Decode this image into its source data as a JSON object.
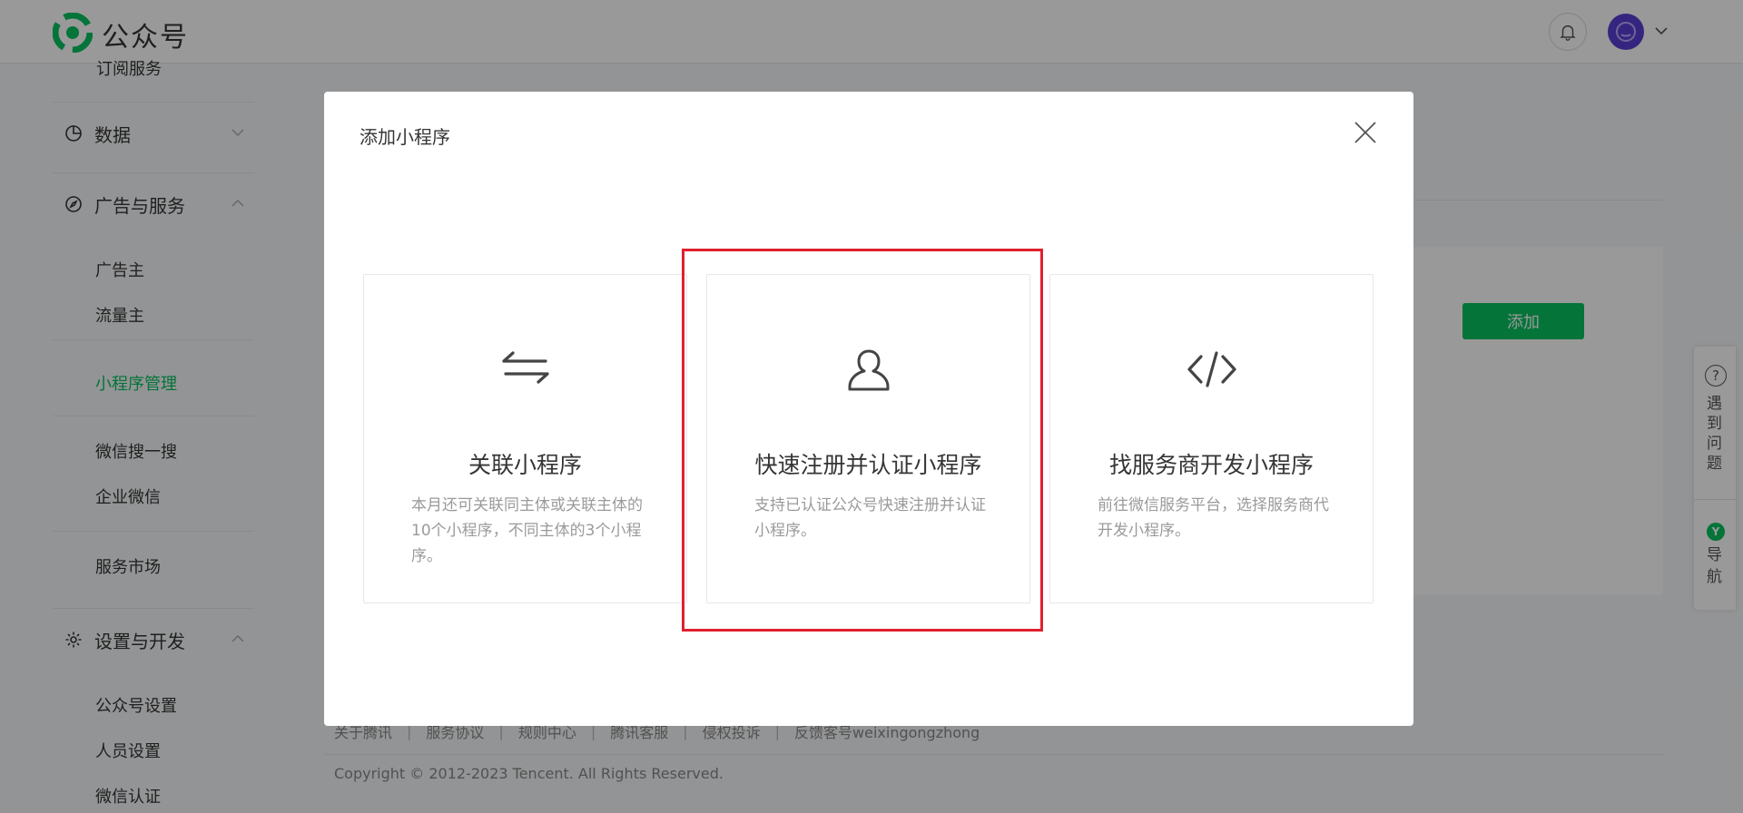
{
  "header": {
    "brand": "公众号",
    "icons": {
      "logo": "wechat-logo",
      "bell": "bell-icon",
      "avatar": "avatar",
      "chevron": "chevron-down-icon"
    }
  },
  "sidebar": {
    "partial_label": "订阅服务",
    "sections": [
      {
        "label": "数据",
        "icon": "pie-chart-icon",
        "expanded": false
      },
      {
        "label": "广告与服务",
        "icon": "compass-icon",
        "expanded": true
      },
      {
        "label": "设置与开发",
        "icon": "gear-icon",
        "expanded": true
      }
    ],
    "ads_items": [
      "广告主",
      "流量主",
      "小程序管理",
      "微信搜一搜",
      "企业微信",
      "服务市场"
    ],
    "settings_items": [
      "公众号设置",
      "人员设置",
      "微信认证"
    ],
    "active_item": "小程序管理"
  },
  "main": {
    "add_button": "添加",
    "footer_links": [
      "关于腾讯",
      "服务协议",
      "规则中心",
      "腾讯客服",
      "侵权投诉",
      "反馈客号weixingongzhong"
    ],
    "copyright": "Copyright © 2012-2023 Tencent. All Rights Reserved."
  },
  "help": {
    "question_mark": "?",
    "help_label": "遇到问题",
    "nav_badge": "Y",
    "nav_label": "导航"
  },
  "modal": {
    "title": "添加小程序",
    "options": [
      {
        "title": "关联小程序",
        "desc": "本月还可关联同主体或关联主体的10个小程序，不同主体的3个小程序。",
        "icon": "swap-arrows-icon"
      },
      {
        "title": "快速注册并认证小程序",
        "desc": "支持已认证公众号快速注册并认证小程序。",
        "icon": "user-icon"
      },
      {
        "title": "找服务商开发小程序",
        "desc": "前往微信服务平台，选择服务商代开发小程序。",
        "icon": "code-icon"
      }
    ]
  },
  "colors": {
    "accent": "#07c160",
    "highlight": "#e0202e",
    "avatar": "#5b3fd4"
  }
}
